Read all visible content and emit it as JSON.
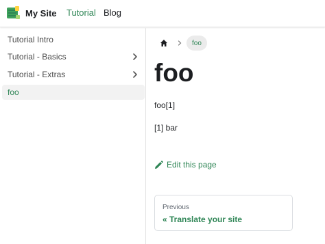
{
  "navbar": {
    "site_title": "My Site",
    "links": [
      {
        "label": "Tutorial",
        "active": true
      },
      {
        "label": "Blog",
        "active": false
      }
    ]
  },
  "sidebar": {
    "items": [
      {
        "label": "Tutorial Intro",
        "has_children": false,
        "active": false
      },
      {
        "label": "Tutorial - Basics",
        "has_children": true,
        "active": false
      },
      {
        "label": "Tutorial - Extras",
        "has_children": true,
        "active": false
      },
      {
        "label": "foo",
        "has_children": false,
        "active": true
      }
    ]
  },
  "breadcrumb": {
    "home_icon": "home-icon",
    "current": "foo"
  },
  "content": {
    "title": "foo",
    "paragraph1": "foo[1]",
    "footnote": "[1] bar",
    "edit_link": "Edit this page"
  },
  "pagination": {
    "sublabel": "Previous",
    "label": "« Translate your site"
  },
  "colors": {
    "accent": "#2e8555",
    "active_bg": "#f2f2f2",
    "border": "#e3e3e3"
  }
}
